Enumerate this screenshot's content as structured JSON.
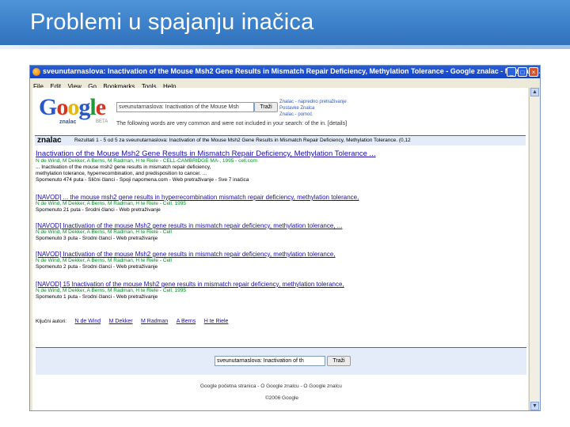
{
  "slide": {
    "title": "Problemi u spajanju inačica"
  },
  "browser": {
    "window_title": "sveunutarnaslova: Inactivation of the Mouse Msh2 Gene Results in Mismatch Repair Deficiency, Methylation Tolerance - Google znalac - Mozilla Fi...",
    "menu": [
      "File",
      "Edit",
      "View",
      "Go",
      "Bookmarks",
      "Tools",
      "Help"
    ],
    "minimize_glyph": "_",
    "maximize_glyph": "□",
    "close_glyph": "×",
    "scroll_up_glyph": "▲",
    "scroll_down_glyph": "▼"
  },
  "google": {
    "logo_letters": [
      "G",
      "o",
      "o",
      "g",
      "l",
      "e"
    ],
    "logo_sub": "znalac",
    "logo_beta": "BETA",
    "search_value": "sveunutarnaslova: Inactivation of the Mouse Msh",
    "search_button": "Traži",
    "advanced_links": [
      "Znalac - napredno pretraživanje",
      "Postavke Znalca",
      "Znalac - pomoć"
    ],
    "info_text": "The following words are very common and were not included in your search: of the in. [details]",
    "results_bar_label": "znalac",
    "results_bar_text": "Rezultati 1 - 5 od 5 za sveunutarnaslova: Inactivation of the Mouse Msh2 Gene Results in Mismatch Repair Deficiency, Methylation Tolerance. (0,12"
  },
  "results": [
    {
      "title": "Inactivation of the Mouse Msh2 Gene Results in Mismatch Repair Deficiency, Methylation Tolerance ...",
      "lines": [
        "N de Wind, M Dekker, A Berns, M Radman, H te Riele - CELL-CAMBRIDGE MA-, 1995 - cell.com",
        "... Inactivation of the mouse msh2 gene results in mismatch repair deficiency,",
        "methylation tolerance, hyperrecombination, and predisposition to cancer. ...",
        "Spomenuto 474 puta - Slični članci - Spoji napomena.com - Web pretraživanje - Sve 7 inačica"
      ]
    },
    {
      "title": "[NAVOD] ... the mouse msh2 gene results in hyperrecombination mismatch repair deficiency, methylation tolerance,",
      "lines": [
        "N de Wind, M Dekker, A Berns, M Radman, H te Riele - Cell, 1995",
        "Spomenuto 21 puta - Srodni članci - Web pretraživanje"
      ]
    },
    {
      "title": "[NAVOD] Inactivation of the mouse Msh2 gene results in mismatch repair deficiency, methylation tolerance, ...",
      "lines": [
        "N de Wind, M Dekker, A Berns, M Radman, H te Riele - Cell",
        "Spomenuto 3 puta - Srodni članci - Web pretraživanje"
      ]
    },
    {
      "title": "[NAVOD] Inactivation of the mouse Msh2 gene results in mismatch repair deficiency, methylation tolerance,",
      "lines": [
        "N de Wind, M Dekker, A Berns, M Radman, H te Riele - Cell",
        "Spomenuto 2 puta - Srodni članci - Web pretraživanje"
      ]
    },
    {
      "title": "[NAVOD] 15 Inactivation of the mouse Msh2 gene results in mismatch repair deficiency, methylation tolerance,",
      "lines": [
        "N de Wind, M Dekker, A Berns, M Radman, H te Riele - Cell, 1995",
        "Spomenuto 1 puta - Srodni članci - Web pretraživanje"
      ]
    }
  ],
  "keywords": {
    "label": "Ključni autori:",
    "authors": [
      "N de Wind",
      "M Dekker",
      "M Radman",
      "A Berns",
      "H te Riele"
    ]
  },
  "bottom": {
    "search_value": "sveunutarnaslova: Inactivation of th",
    "search_button": "Traži",
    "footer_links": "Google početna stranica - O Google znalcu - O Google znalcu",
    "copyright": "©2006 Google"
  }
}
